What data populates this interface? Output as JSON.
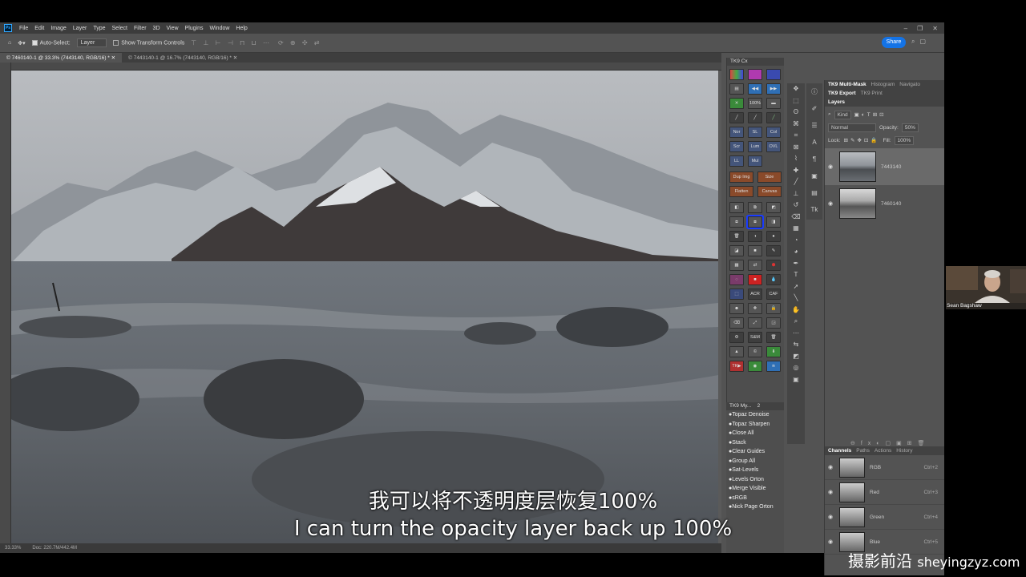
{
  "menubar": {
    "logo": "Ps",
    "items": [
      "File",
      "Edit",
      "Image",
      "Layer",
      "Type",
      "Select",
      "Filter",
      "3D",
      "View",
      "Plugins",
      "Window",
      "Help"
    ]
  },
  "options": {
    "auto_select_label": "Auto-Select:",
    "auto_select_value": "Layer",
    "transform_label": "Show Transform Controls",
    "share_label": "Share"
  },
  "doc_tabs": [
    {
      "label": "© 7460140-1 @ 33.3% (7443140, RGB/16) *",
      "active": true
    },
    {
      "label": "© 7443140-1 @ 16.7% (7443140, RGB/16) *",
      "active": false
    }
  ],
  "status": {
    "zoom": "33.33%",
    "doc": "Doc: 220.7M/442.4M"
  },
  "tk9": {
    "title": "TK9 Cx",
    "row_labels": {
      "zoom": "100%",
      "blend": [
        "Nor",
        "SL",
        "Col",
        "Scr",
        "Lum",
        "OVL",
        "LL",
        "Mul"
      ],
      "dup": "Dup Img",
      "size": "Size",
      "flatten": "Flatten",
      "canvas": "Canvas",
      "acr": "ACR",
      "caf": "CAF",
      "snm": "S&M",
      "tk": "TK▶"
    },
    "my_title": "TK9 My...",
    "my_num": "2",
    "my_items": [
      "●Topaz Denoise",
      "●Topaz Sharpen",
      "●Close All",
      "●Stack",
      "●Clear Guides",
      "●Group All",
      "●Sat-Levels",
      "●Levels Orton",
      "●Merge Visible",
      "●sRGB",
      "●Nick Page Orton"
    ]
  },
  "right_panel": {
    "tabs_row1": [
      "TK9 Multi-Mask",
      "Histogram",
      "Navigato"
    ],
    "tabs_row2": [
      "TK9 Export",
      "TK9 Print"
    ],
    "layers_title": "Layers",
    "kind": "Kind",
    "blend_mode": "Normal",
    "opacity_label": "Opacity:",
    "opacity_value": "50%",
    "lock_label": "Lock:",
    "fill_label": "Fill:",
    "fill_value": "100%",
    "layers": [
      {
        "name": "7443140",
        "selected": true
      },
      {
        "name": "7460140",
        "selected": false
      }
    ],
    "channel_tabs": [
      "Channels",
      "Paths",
      "Actions",
      "History"
    ],
    "channels": [
      {
        "name": "RGB",
        "key": "Ctrl+2"
      },
      {
        "name": "Red",
        "key": "Ctrl+3"
      },
      {
        "name": "Green",
        "key": "Ctrl+4"
      },
      {
        "name": "Blue",
        "key": "Ctrl+5"
      }
    ]
  },
  "webcam": {
    "name": "Sean Bagshaw"
  },
  "subtitle": {
    "zh": "我可以将不透明度层恢复100%",
    "en": "I can turn the opacity layer back up 100%"
  },
  "watermark": {
    "cn": "摄影前沿",
    "url": "sheyingzyz.com"
  },
  "colors": {
    "ps_bg": "#535353",
    "accent": "#1473e6",
    "selection": "#1a3cff"
  }
}
